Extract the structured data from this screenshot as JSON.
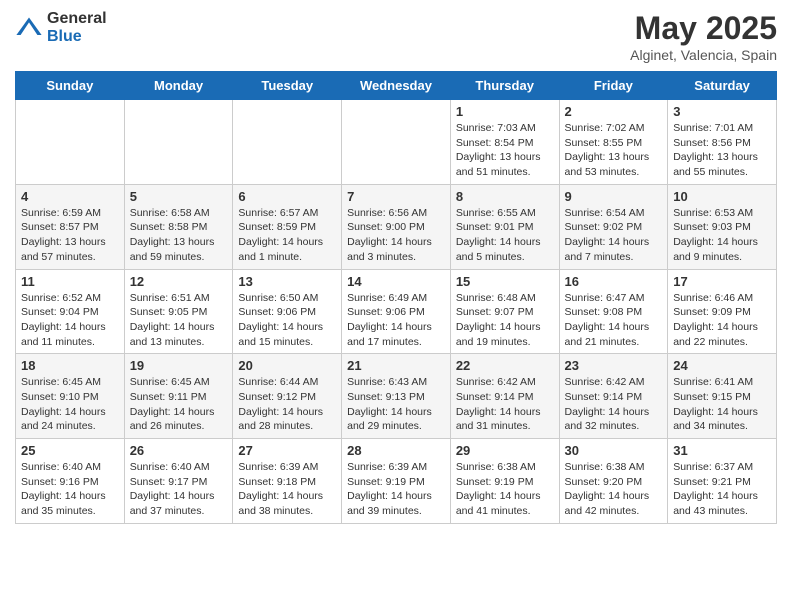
{
  "header": {
    "logo_general": "General",
    "logo_blue": "Blue",
    "month_title": "May 2025",
    "location": "Alginet, Valencia, Spain"
  },
  "days_of_week": [
    "Sunday",
    "Monday",
    "Tuesday",
    "Wednesday",
    "Thursday",
    "Friday",
    "Saturday"
  ],
  "weeks": [
    [
      {
        "day": "",
        "info": ""
      },
      {
        "day": "",
        "info": ""
      },
      {
        "day": "",
        "info": ""
      },
      {
        "day": "",
        "info": ""
      },
      {
        "day": "1",
        "info": "Sunrise: 7:03 AM\nSunset: 8:54 PM\nDaylight: 13 hours\nand 51 minutes."
      },
      {
        "day": "2",
        "info": "Sunrise: 7:02 AM\nSunset: 8:55 PM\nDaylight: 13 hours\nand 53 minutes."
      },
      {
        "day": "3",
        "info": "Sunrise: 7:01 AM\nSunset: 8:56 PM\nDaylight: 13 hours\nand 55 minutes."
      }
    ],
    [
      {
        "day": "4",
        "info": "Sunrise: 6:59 AM\nSunset: 8:57 PM\nDaylight: 13 hours\nand 57 minutes."
      },
      {
        "day": "5",
        "info": "Sunrise: 6:58 AM\nSunset: 8:58 PM\nDaylight: 13 hours\nand 59 minutes."
      },
      {
        "day": "6",
        "info": "Sunrise: 6:57 AM\nSunset: 8:59 PM\nDaylight: 14 hours\nand 1 minute."
      },
      {
        "day": "7",
        "info": "Sunrise: 6:56 AM\nSunset: 9:00 PM\nDaylight: 14 hours\nand 3 minutes."
      },
      {
        "day": "8",
        "info": "Sunrise: 6:55 AM\nSunset: 9:01 PM\nDaylight: 14 hours\nand 5 minutes."
      },
      {
        "day": "9",
        "info": "Sunrise: 6:54 AM\nSunset: 9:02 PM\nDaylight: 14 hours\nand 7 minutes."
      },
      {
        "day": "10",
        "info": "Sunrise: 6:53 AM\nSunset: 9:03 PM\nDaylight: 14 hours\nand 9 minutes."
      }
    ],
    [
      {
        "day": "11",
        "info": "Sunrise: 6:52 AM\nSunset: 9:04 PM\nDaylight: 14 hours\nand 11 minutes."
      },
      {
        "day": "12",
        "info": "Sunrise: 6:51 AM\nSunset: 9:05 PM\nDaylight: 14 hours\nand 13 minutes."
      },
      {
        "day": "13",
        "info": "Sunrise: 6:50 AM\nSunset: 9:06 PM\nDaylight: 14 hours\nand 15 minutes."
      },
      {
        "day": "14",
        "info": "Sunrise: 6:49 AM\nSunset: 9:06 PM\nDaylight: 14 hours\nand 17 minutes."
      },
      {
        "day": "15",
        "info": "Sunrise: 6:48 AM\nSunset: 9:07 PM\nDaylight: 14 hours\nand 19 minutes."
      },
      {
        "day": "16",
        "info": "Sunrise: 6:47 AM\nSunset: 9:08 PM\nDaylight: 14 hours\nand 21 minutes."
      },
      {
        "day": "17",
        "info": "Sunrise: 6:46 AM\nSunset: 9:09 PM\nDaylight: 14 hours\nand 22 minutes."
      }
    ],
    [
      {
        "day": "18",
        "info": "Sunrise: 6:45 AM\nSunset: 9:10 PM\nDaylight: 14 hours\nand 24 minutes."
      },
      {
        "day": "19",
        "info": "Sunrise: 6:45 AM\nSunset: 9:11 PM\nDaylight: 14 hours\nand 26 minutes."
      },
      {
        "day": "20",
        "info": "Sunrise: 6:44 AM\nSunset: 9:12 PM\nDaylight: 14 hours\nand 28 minutes."
      },
      {
        "day": "21",
        "info": "Sunrise: 6:43 AM\nSunset: 9:13 PM\nDaylight: 14 hours\nand 29 minutes."
      },
      {
        "day": "22",
        "info": "Sunrise: 6:42 AM\nSunset: 9:14 PM\nDaylight: 14 hours\nand 31 minutes."
      },
      {
        "day": "23",
        "info": "Sunrise: 6:42 AM\nSunset: 9:14 PM\nDaylight: 14 hours\nand 32 minutes."
      },
      {
        "day": "24",
        "info": "Sunrise: 6:41 AM\nSunset: 9:15 PM\nDaylight: 14 hours\nand 34 minutes."
      }
    ],
    [
      {
        "day": "25",
        "info": "Sunrise: 6:40 AM\nSunset: 9:16 PM\nDaylight: 14 hours\nand 35 minutes."
      },
      {
        "day": "26",
        "info": "Sunrise: 6:40 AM\nSunset: 9:17 PM\nDaylight: 14 hours\nand 37 minutes."
      },
      {
        "day": "27",
        "info": "Sunrise: 6:39 AM\nSunset: 9:18 PM\nDaylight: 14 hours\nand 38 minutes."
      },
      {
        "day": "28",
        "info": "Sunrise: 6:39 AM\nSunset: 9:19 PM\nDaylight: 14 hours\nand 39 minutes."
      },
      {
        "day": "29",
        "info": "Sunrise: 6:38 AM\nSunset: 9:19 PM\nDaylight: 14 hours\nand 41 minutes."
      },
      {
        "day": "30",
        "info": "Sunrise: 6:38 AM\nSunset: 9:20 PM\nDaylight: 14 hours\nand 42 minutes."
      },
      {
        "day": "31",
        "info": "Sunrise: 6:37 AM\nSunset: 9:21 PM\nDaylight: 14 hours\nand 43 minutes."
      }
    ]
  ]
}
